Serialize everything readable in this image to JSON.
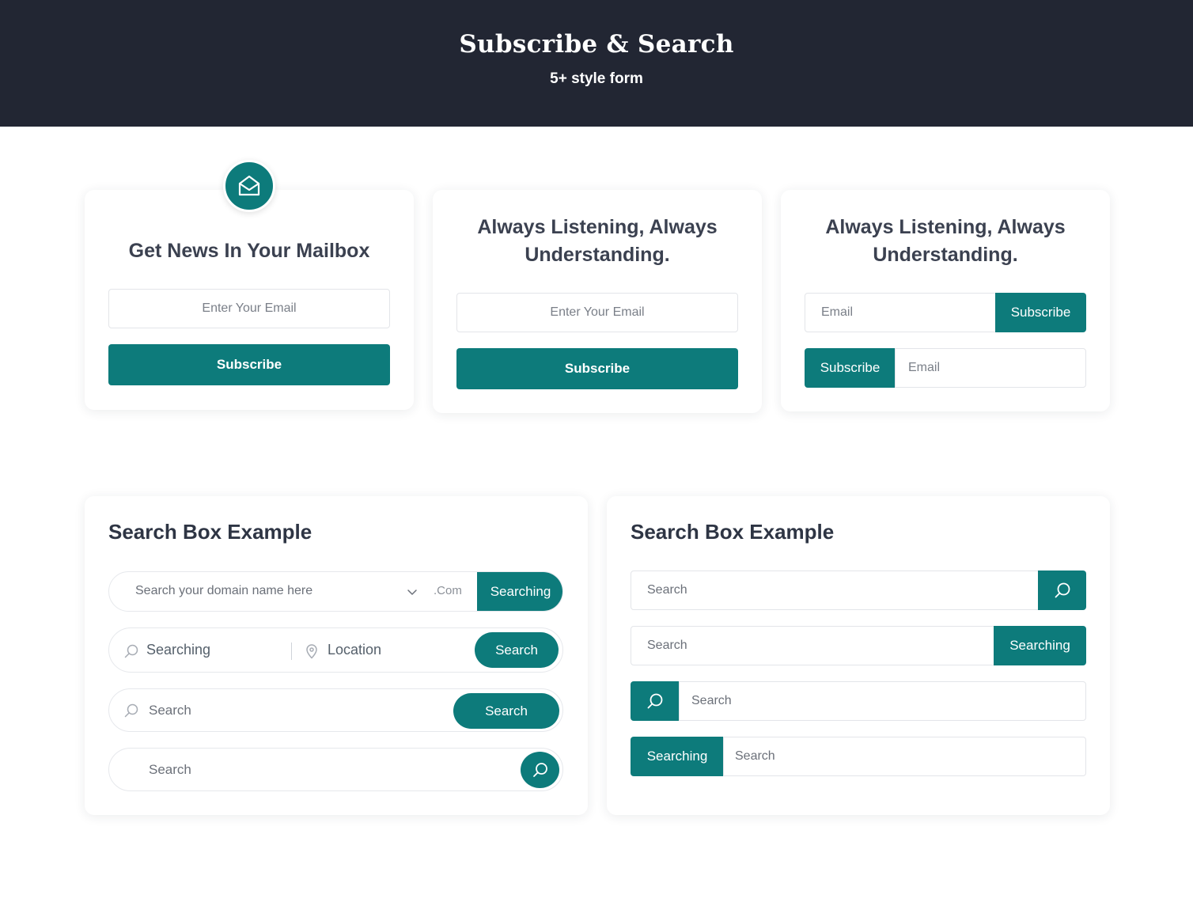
{
  "header": {
    "title": "Subscribe & Search",
    "subtitle": "5+ style form"
  },
  "subscribe_cards": [
    {
      "title": "Get News In Your Mailbox",
      "email_placeholder": "Enter Your Email",
      "button_label": "Subscribe",
      "icon": "envelope-open-icon"
    },
    {
      "title": "Always Listening, Always Understanding.",
      "email_placeholder": "Enter Your Email",
      "button_label": "Subscribe"
    },
    {
      "title": "Always Listening, Always Understanding.",
      "row1": {
        "placeholder": "Email",
        "button_label": "Subscribe"
      },
      "row2": {
        "button_label": "Subscribe",
        "placeholder": "Email"
      }
    }
  ],
  "search_left": {
    "title": "Search Box Example",
    "domain": {
      "placeholder": "Search your domain name here",
      "suffix": ".Com",
      "button_label": "Searching"
    },
    "job": {
      "keyword_placeholder": "Searching",
      "location_placeholder": "Location",
      "button_label": "Search"
    },
    "simple": {
      "placeholder": "Search",
      "button_label": "Search"
    },
    "icon_button": {
      "placeholder": "Search",
      "icon": "search-icon"
    }
  },
  "search_right": {
    "title": "Search Box Example",
    "box1": {
      "placeholder": "Search",
      "icon": "search-icon"
    },
    "box2": {
      "placeholder": "Search",
      "button_label": "Searching"
    },
    "box3": {
      "icon": "search-icon",
      "placeholder": "Search"
    },
    "box4": {
      "button_label": "Searching",
      "placeholder": "Search"
    }
  },
  "colors": {
    "header_bg": "#222633",
    "accent": "#0d7b7b",
    "text_dark": "#2e3544",
    "border": "#e3e5e9"
  }
}
